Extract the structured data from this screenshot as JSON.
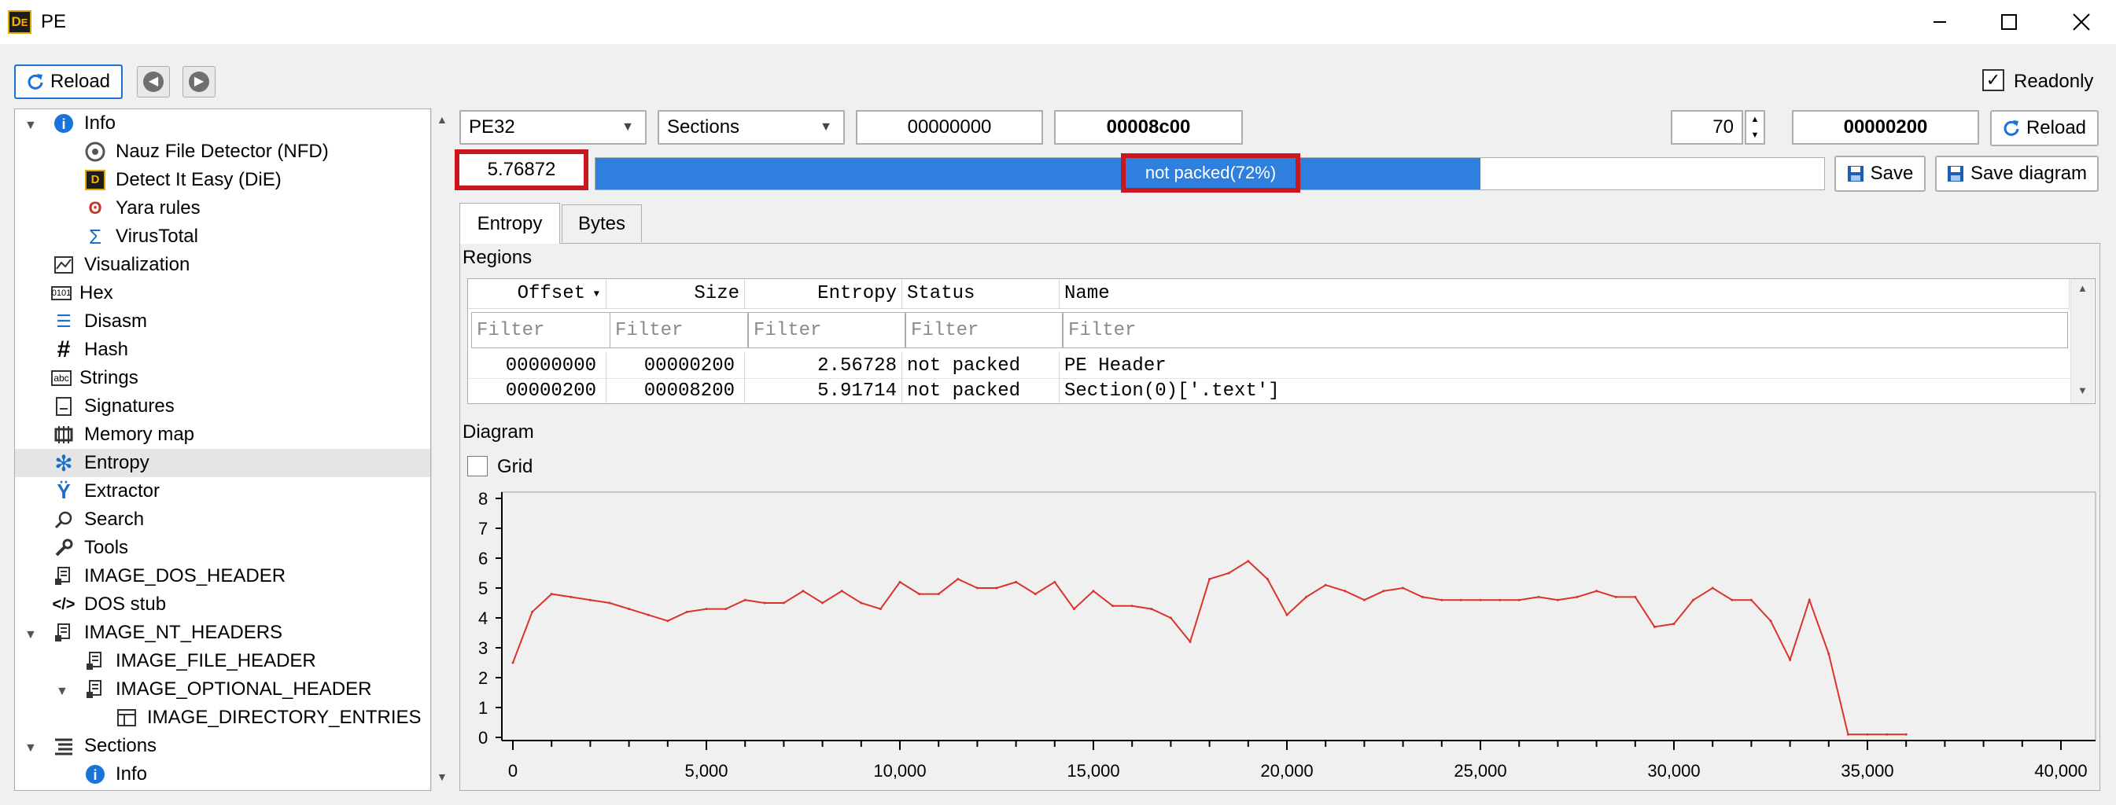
{
  "window": {
    "title": "PE",
    "app_icon": "die-icon"
  },
  "toolbar": {
    "reload": "Reload",
    "readonly": "Readonly",
    "readonly_checked": true
  },
  "tree": {
    "items": [
      {
        "label": "Info",
        "icon": "info-icon",
        "level": 0,
        "expanded": true
      },
      {
        "label": "Nauz File Detector (NFD)",
        "icon": "nfd-icon",
        "level": 1
      },
      {
        "label": "Detect It Easy (DiE)",
        "icon": "die-icon",
        "level": 1
      },
      {
        "label": "Yara rules",
        "icon": "yara-icon",
        "level": 1
      },
      {
        "label": "VirusTotal",
        "icon": "sigma-icon",
        "level": 1
      },
      {
        "label": "Visualization",
        "icon": "visualization-icon",
        "level": 0
      },
      {
        "label": "Hex",
        "icon": "hex-icon",
        "level": 0
      },
      {
        "label": "Disasm",
        "icon": "disasm-icon",
        "level": 0
      },
      {
        "label": "Hash",
        "icon": "hash-icon",
        "level": 0
      },
      {
        "label": "Strings",
        "icon": "strings-icon",
        "level": 0
      },
      {
        "label": "Signatures",
        "icon": "signatures-icon",
        "level": 0
      },
      {
        "label": "Memory map",
        "icon": "memory-icon",
        "level": 0
      },
      {
        "label": "Entropy",
        "icon": "entropy-icon",
        "level": 0,
        "selected": true
      },
      {
        "label": "Extractor",
        "icon": "extractor-icon",
        "level": 0
      },
      {
        "label": "Search",
        "icon": "search-icon",
        "level": 0
      },
      {
        "label": "Tools",
        "icon": "wrench-icon",
        "level": 0
      },
      {
        "label": "IMAGE_DOS_HEADER",
        "icon": "header-icon",
        "level": 0
      },
      {
        "label": "DOS stub",
        "icon": "code-icon",
        "level": 0
      },
      {
        "label": "IMAGE_NT_HEADERS",
        "icon": "header-icon",
        "level": 0,
        "expanded": true
      },
      {
        "label": "IMAGE_FILE_HEADER",
        "icon": "header-icon",
        "level": 1
      },
      {
        "label": "IMAGE_OPTIONAL_HEADER",
        "icon": "header-icon",
        "level": 1,
        "expanded": true
      },
      {
        "label": "IMAGE_DIRECTORY_ENTRIES",
        "icon": "table-icon",
        "level": 2
      },
      {
        "label": "Sections",
        "icon": "sections-icon",
        "level": 0,
        "expanded": true
      },
      {
        "label": "Info",
        "icon": "info-icon",
        "level": 1
      }
    ]
  },
  "controls": {
    "type_combo": "PE32",
    "mode_combo": "Sections",
    "offset": "00000000",
    "size": "00008c00",
    "count": "70",
    "count_hex": "00000200",
    "reload": "Reload",
    "entropy_value": "5.76872",
    "progress_label": "not packed(72%)",
    "progress_fraction": 0.72,
    "save": "Save",
    "save_diagram": "Save diagram"
  },
  "tabs": [
    {
      "label": "Entropy",
      "active": true
    },
    {
      "label": "Bytes",
      "active": false
    }
  ],
  "regions": {
    "title": "Regions",
    "columns": [
      "Offset",
      "Size",
      "Entropy",
      "Status",
      "Name"
    ],
    "filter_placeholder": "Filter",
    "rows": [
      [
        "00000000",
        "00000200",
        "2.56728",
        "not packed",
        "PE Header"
      ],
      [
        "00000200",
        "00008200",
        "5.91714",
        "not packed",
        "Section(0)['.text']"
      ]
    ]
  },
  "diagram": {
    "title": "Diagram",
    "grid_label": "Grid",
    "grid_checked": false
  },
  "chart_data": {
    "type": "line",
    "title": "",
    "xlabel": "",
    "ylabel": "",
    "xlim": [
      0,
      40000
    ],
    "ylim": [
      0,
      8
    ],
    "x_ticks": [
      "0",
      "5,000",
      "10,000",
      "15,000",
      "20,000",
      "25,000",
      "30,000",
      "35,000",
      "40,000"
    ],
    "y_ticks": [
      "0",
      "1",
      "2",
      "3",
      "4",
      "5",
      "6",
      "7",
      "8"
    ],
    "grid": false,
    "color": "#d9342b",
    "series": [
      {
        "x": [
          0,
          500,
          1000,
          1500,
          2000,
          2500,
          3000,
          3500,
          4000,
          4500,
          5000,
          5500,
          6000,
          6500,
          7000,
          7500,
          8000,
          8500,
          9000,
          9500,
          10000,
          10500,
          11000,
          11500,
          12000,
          12500,
          13000,
          13500,
          14000,
          14500,
          15000,
          15500,
          16000,
          16500,
          17000,
          17500,
          18000,
          18500,
          19000,
          19500,
          20000,
          20500,
          21000,
          21500,
          22000,
          22500,
          23000,
          23500,
          24000,
          24500,
          25000,
          25500,
          26000,
          26500,
          27000,
          27500,
          28000,
          28500,
          29000,
          29500,
          30000,
          30500,
          31000,
          31500,
          32000,
          32500,
          33000,
          33500,
          34000,
          34500,
          35000,
          35500,
          36000
        ],
        "y": [
          2.5,
          4.2,
          4.8,
          4.7,
          4.6,
          4.5,
          4.3,
          4.1,
          3.9,
          4.2,
          4.3,
          4.3,
          4.6,
          4.5,
          4.5,
          4.9,
          4.5,
          4.9,
          4.5,
          4.3,
          5.2,
          4.8,
          4.8,
          5.3,
          5.0,
          5.0,
          5.2,
          4.8,
          5.2,
          4.3,
          4.9,
          4.4,
          4.4,
          4.3,
          4.0,
          3.2,
          5.3,
          5.5,
          5.9,
          5.3,
          4.1,
          4.7,
          5.1,
          4.9,
          4.6,
          4.9,
          5.0,
          4.7,
          4.6,
          4.6,
          4.6,
          4.6,
          4.6,
          4.7,
          4.6,
          4.7,
          4.9,
          4.7,
          4.7,
          3.7,
          3.8,
          4.6,
          5.0,
          4.6,
          4.6,
          3.9,
          2.6,
          4.6,
          2.8,
          0.1,
          0.1,
          0.1,
          0.1
        ]
      }
    ]
  }
}
